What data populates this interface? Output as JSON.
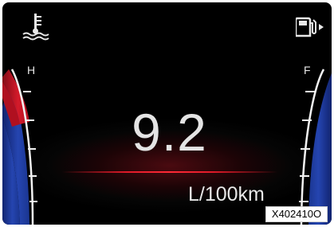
{
  "temp_gauge": {
    "top_label": "H",
    "level": 0.5
  },
  "fuel_gauge": {
    "top_label": "F",
    "level": 0.95
  },
  "readout": {
    "value": "9.2",
    "unit": "L/100km"
  },
  "figure_code": "X402410O",
  "colors": {
    "background": "#000000",
    "hot_zone": "#c8102e",
    "gauge_blue": "#1f3a9a",
    "divider": "#e01a28",
    "text": "#e4e4e4"
  },
  "icons": [
    "coolant-temperature-icon",
    "fuel-pump-icon"
  ]
}
